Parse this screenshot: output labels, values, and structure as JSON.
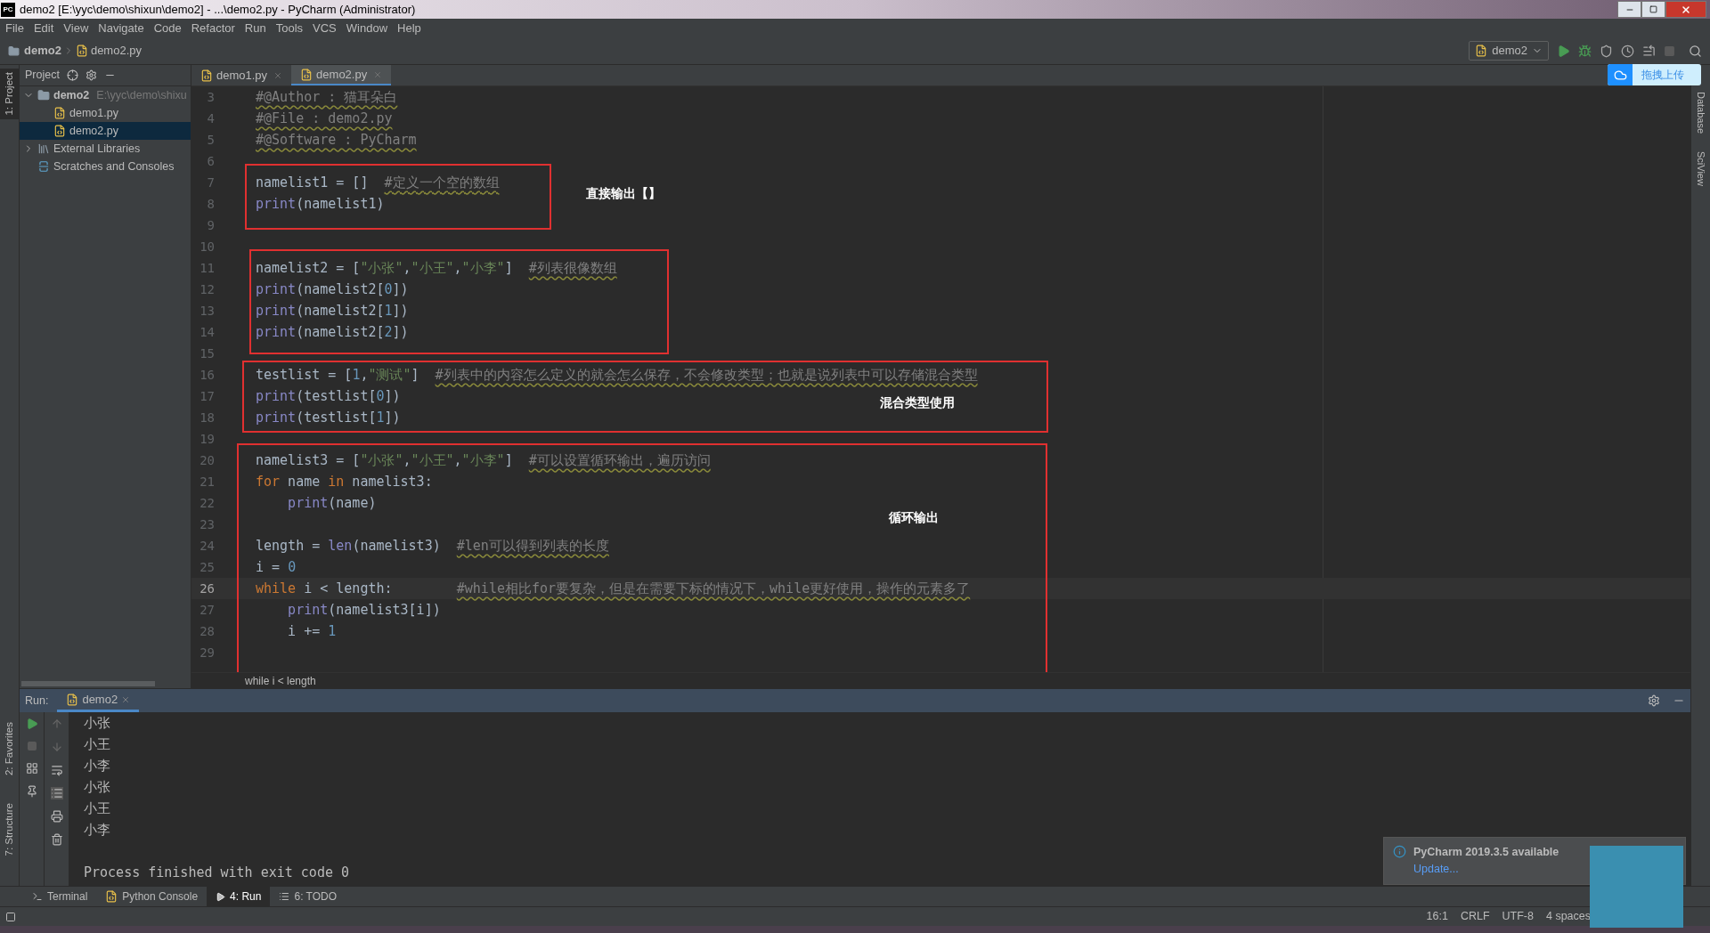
{
  "window": {
    "title": "demo2 [E:\\yyc\\demo\\shixun\\demo2] - ...\\demo2.py - PyCharm (Administrator)",
    "app_badge": "PC"
  },
  "menu": [
    "File",
    "Edit",
    "View",
    "Navigate",
    "Code",
    "Refactor",
    "Run",
    "Tools",
    "VCS",
    "Window",
    "Help"
  ],
  "nav": {
    "project": "demo2",
    "file": "demo2.py",
    "run_config": "demo2"
  },
  "upload_button": "拖拽上传",
  "left_stripe": {
    "top": [
      "1: Project"
    ],
    "bottom": [
      "2: Favorites",
      "7: Structure"
    ]
  },
  "right_stripe": [
    "Database",
    "SciView"
  ],
  "project_panel": {
    "title": "Project",
    "tree": [
      {
        "label": "demo2",
        "path": "E:\\yyc\\demo\\shixu",
        "kind": "folder",
        "expanded": true,
        "selected": false,
        "children": [
          {
            "label": "demo1.py",
            "kind": "py",
            "selected": false
          },
          {
            "label": "demo2.py",
            "kind": "py",
            "selected": true
          }
        ]
      },
      {
        "label": "External Libraries",
        "kind": "lib",
        "expanded": false,
        "selected": false
      },
      {
        "label": "Scratches and Consoles",
        "kind": "scratch",
        "selected": false
      }
    ]
  },
  "editor_tabs": [
    {
      "label": "demo1.py",
      "selected": false
    },
    {
      "label": "demo2.py",
      "selected": true
    }
  ],
  "code_blocks": [
    {
      "annotated": false,
      "lines": [
        {
          "no": "3",
          "current": false,
          "tokens": [
            {
              "kind": "comment",
              "text": "#@Author : 猫耳朵白"
            }
          ]
        },
        {
          "no": "4",
          "current": false,
          "tokens": [
            {
              "kind": "comment",
              "text": "#@File : demo2.py"
            }
          ]
        },
        {
          "no": "5",
          "current": false,
          "tokens": [
            {
              "kind": "comment",
              "text": "#@Software : PyCharm"
            }
          ]
        },
        {
          "no": "6",
          "current": false
        }
      ]
    },
    {
      "annotated": true,
      "label": "直接输出【】",
      "lines": [
        {
          "no": "7",
          "current": false,
          "tokens": [
            {
              "kind": "plain",
              "text": "namelist1 = []  "
            },
            {
              "kind": "comment",
              "text": "#定义一个空的数组"
            }
          ]
        },
        {
          "no": "8",
          "current": false,
          "tokens": [
            {
              "kind": "builtin",
              "text": "print"
            },
            {
              "kind": "plain",
              "text": "(namelist1)"
            }
          ]
        }
      ]
    },
    {
      "annotated": false,
      "lines": [
        {
          "no": "9",
          "current": false
        },
        {
          "no": "10",
          "current": false
        }
      ]
    },
    {
      "annotated": true,
      "lines": [
        {
          "no": "11",
          "current": false,
          "tokens": [
            {
              "kind": "plain",
              "text": "namelist2 = ["
            },
            {
              "kind": "string",
              "text": "\"小张\""
            },
            {
              "kind": "plain",
              "text": ","
            },
            {
              "kind": "string",
              "text": "\"小王\""
            },
            {
              "kind": "plain",
              "text": ","
            },
            {
              "kind": "string",
              "text": "\"小李\""
            },
            {
              "kind": "plain",
              "text": "]  "
            },
            {
              "kind": "comment",
              "text": "#列表很像数组"
            }
          ]
        },
        {
          "no": "12",
          "current": false,
          "tokens": [
            {
              "kind": "builtin",
              "text": "print"
            },
            {
              "kind": "plain",
              "text": "(namelist2["
            },
            {
              "kind": "number",
              "text": "0"
            },
            {
              "kind": "plain",
              "text": "])"
            }
          ]
        },
        {
          "no": "13",
          "current": false,
          "tokens": [
            {
              "kind": "builtin",
              "text": "print"
            },
            {
              "kind": "plain",
              "text": "(namelist2["
            },
            {
              "kind": "number",
              "text": "1"
            },
            {
              "kind": "plain",
              "text": "])"
            }
          ]
        },
        {
          "no": "14",
          "current": false,
          "tokens": [
            {
              "kind": "builtin",
              "text": "print"
            },
            {
              "kind": "plain",
              "text": "(namelist2["
            },
            {
              "kind": "number",
              "text": "2"
            },
            {
              "kind": "plain",
              "text": "])"
            }
          ]
        }
      ]
    },
    {
      "annotated": false,
      "lines": [
        {
          "no": "15",
          "current": false
        }
      ]
    },
    {
      "annotated": true,
      "label": "混合类型使用",
      "lines": [
        {
          "no": "16",
          "current": false,
          "tokens": [
            {
              "kind": "plain",
              "text": "testlist = ["
            },
            {
              "kind": "number",
              "text": "1"
            },
            {
              "kind": "plain",
              "text": ","
            },
            {
              "kind": "string",
              "text": "\"测试\""
            },
            {
              "kind": "plain",
              "text": "]  "
            },
            {
              "kind": "comment",
              "text": "#列表中的内容怎么定义的就会怎么保存，不会修改类型；也就是说列表中可以存储混合类型"
            }
          ]
        },
        {
          "no": "17",
          "current": false,
          "tokens": [
            {
              "kind": "builtin",
              "text": "print"
            },
            {
              "kind": "plain",
              "text": "(testlist["
            },
            {
              "kind": "number",
              "text": "0"
            },
            {
              "kind": "plain",
              "text": "])"
            }
          ]
        },
        {
          "no": "18",
          "current": false,
          "tokens": [
            {
              "kind": "builtin",
              "text": "print"
            },
            {
              "kind": "plain",
              "text": "(testlist["
            },
            {
              "kind": "number",
              "text": "1"
            },
            {
              "kind": "plain",
              "text": "])"
            }
          ]
        }
      ]
    },
    {
      "annotated": false,
      "lines": [
        {
          "no": "19",
          "current": false
        }
      ]
    },
    {
      "annotated": true,
      "label": "循环输出",
      "lines": [
        {
          "no": "20",
          "current": false,
          "tokens": [
            {
              "kind": "plain",
              "text": "namelist3 = ["
            },
            {
              "kind": "string",
              "text": "\"小张\""
            },
            {
              "kind": "plain",
              "text": ","
            },
            {
              "kind": "string",
              "text": "\"小王\""
            },
            {
              "kind": "plain",
              "text": ","
            },
            {
              "kind": "string",
              "text": "\"小李\""
            },
            {
              "kind": "plain",
              "text": "]  "
            },
            {
              "kind": "comment",
              "text": "#可以设置循环输出，遍历访问"
            }
          ]
        },
        {
          "no": "21",
          "current": false,
          "tokens": [
            {
              "kind": "keyword",
              "text": "for"
            },
            {
              "kind": "plain",
              "text": " name "
            },
            {
              "kind": "keyword",
              "text": "in"
            },
            {
              "kind": "plain",
              "text": " namelist3:"
            }
          ]
        },
        {
          "no": "22",
          "current": false,
          "tokens": [
            {
              "kind": "builtin",
              "text": "    print"
            },
            {
              "kind": "plain",
              "text": "(name)"
            }
          ]
        },
        {
          "no": "23",
          "current": false
        },
        {
          "no": "24",
          "current": false,
          "tokens": [
            {
              "kind": "plain",
              "text": "length = "
            },
            {
              "kind": "builtin",
              "text": "len"
            },
            {
              "kind": "plain",
              "text": "(namelist3)  "
            },
            {
              "kind": "comment",
              "text": "#len可以得到列表的长度"
            }
          ]
        },
        {
          "no": "25",
          "current": false,
          "tokens": [
            {
              "kind": "plain",
              "text": "i = "
            },
            {
              "kind": "number",
              "text": "0"
            }
          ]
        },
        {
          "no": "26",
          "current": true,
          "tokens": [
            {
              "kind": "keyword",
              "text": "while"
            },
            {
              "kind": "plain",
              "text": " i < length:        "
            },
            {
              "kind": "comment",
              "text": "#while相比for要复杂，但是在需要下标的情况下，while更好使用，操作的元素多了"
            }
          ]
        },
        {
          "no": "27",
          "current": false,
          "tokens": [
            {
              "kind": "builtin",
              "text": "    print"
            },
            {
              "kind": "plain",
              "text": "(namelist3[i])"
            }
          ]
        },
        {
          "no": "28",
          "current": false,
          "tokens": [
            {
              "kind": "plain",
              "text": "    i += "
            },
            {
              "kind": "number",
              "text": "1"
            }
          ]
        },
        {
          "no": "29",
          "current": false
        }
      ]
    }
  ],
  "breadcrumb": "while i < length",
  "run_panel": {
    "label": "Run:",
    "tabs": [
      {
        "label": "demo2",
        "selected": true
      }
    ],
    "output": [
      "小张",
      "小王",
      "小李",
      "小张",
      "小王",
      "小李"
    ],
    "exit_message": "Process finished with exit code 0"
  },
  "tool_tabs": [
    {
      "label": "Terminal",
      "kind": "terminal",
      "selected": false
    },
    {
      "label": "Python Console",
      "kind": "python",
      "selected": false
    },
    {
      "label": "4: Run",
      "kind": "run",
      "selected": true
    },
    {
      "label": "6: TODO",
      "kind": "todo",
      "selected": false
    }
  ],
  "notification": {
    "title": "PyCharm 2019.3.5 available",
    "link": "Update..."
  },
  "status_bar": [
    "16:1",
    "CRLF",
    "UTF-8",
    "4 spaces"
  ]
}
